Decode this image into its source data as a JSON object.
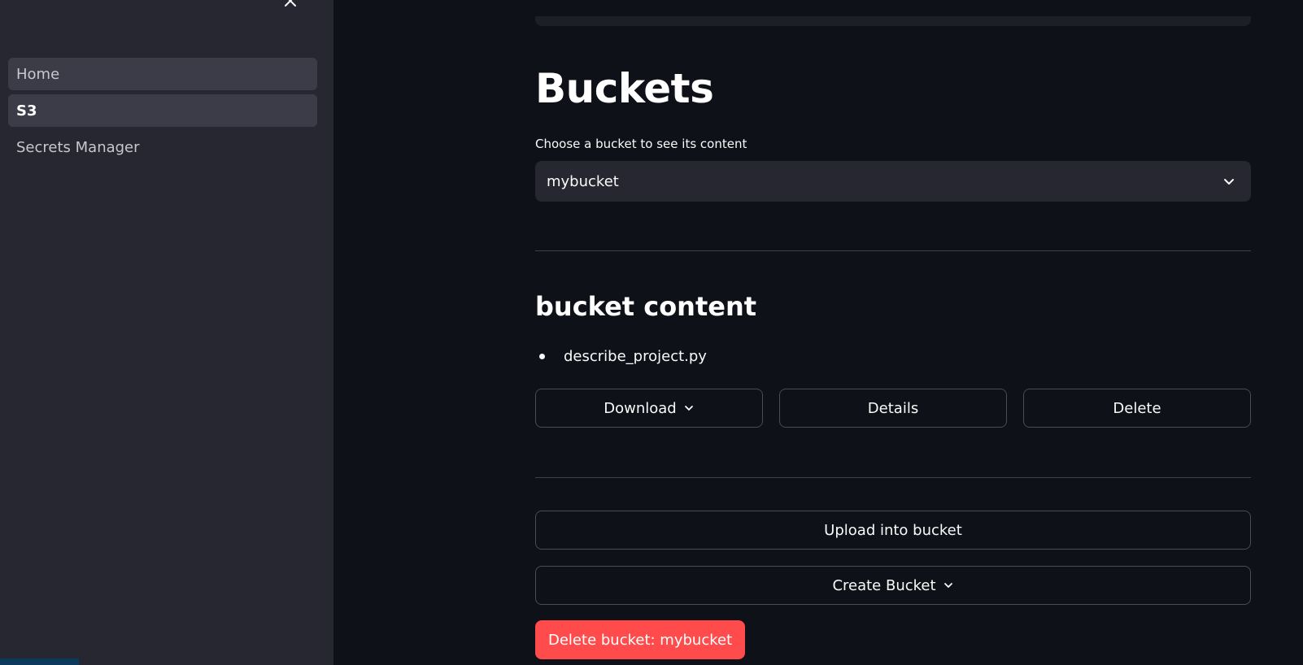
{
  "sidebar": {
    "close_icon": "close-icon",
    "items": [
      {
        "label": "Home",
        "state": "hover"
      },
      {
        "label": "S3",
        "state": "current"
      },
      {
        "label": "Secrets Manager",
        "state": "default"
      }
    ]
  },
  "main": {
    "title": "Buckets",
    "bucket_select": {
      "label": "Choose a bucket to see its content",
      "value": "mybucket",
      "icon": "chevron-down-icon"
    },
    "content_heading": "bucket content",
    "files": [
      "describe_project.py"
    ],
    "file_actions": {
      "download_label": "Download",
      "details_label": "Details",
      "delete_label": "Delete"
    },
    "upload_label": "Upload into bucket",
    "create_bucket_label": "Create Bucket",
    "delete_bucket_label": "Delete bucket: mybucket"
  },
  "colors": {
    "background": "#0e1117",
    "sidebar": "#262730",
    "danger": "#ff4b4b"
  }
}
